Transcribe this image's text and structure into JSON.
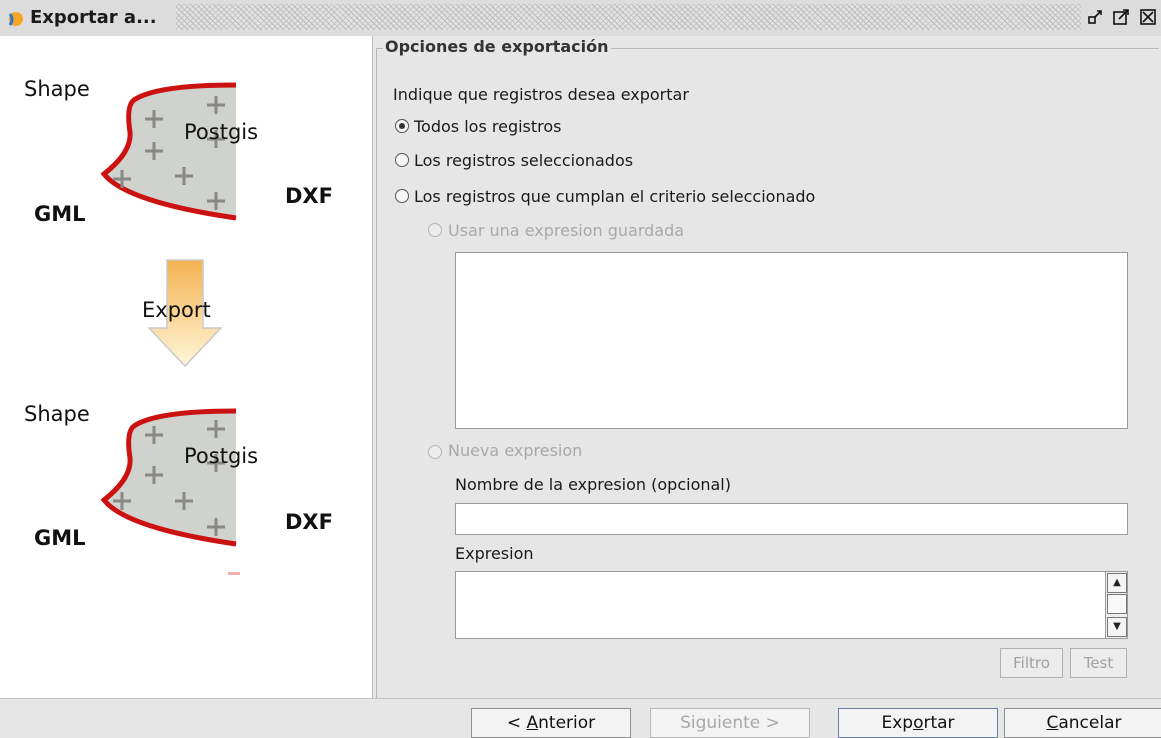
{
  "window": {
    "title": "Exportar a..."
  },
  "illustration": {
    "top": {
      "shape": "Shape",
      "postgis": "Postgis",
      "gml": "GML",
      "dxf": "DXF"
    },
    "arrow_label": "Export",
    "bottom": {
      "shape": "Shape",
      "postgis": "Postgis",
      "gml": "GML",
      "dxf": "DXF"
    }
  },
  "options": {
    "legend": "Opciones de exportación",
    "prompt": "Indique que registros desea exportar",
    "radio_all": "Todos los registros",
    "radio_selected": "Los registros seleccionados",
    "radio_criteria": "Los registros que cumplan el criterio seleccionado",
    "radio_saved": "Usar una expresion guardada",
    "radio_new": "Nueva expresion",
    "name_label": "Nombre de la expresion (opcional)",
    "name_value": "",
    "expr_label": "Expresion",
    "expr_value": "",
    "filter_btn": "Filtro",
    "test_btn": "Test",
    "selected_option": "Todos los registros"
  },
  "nav": {
    "back_mnemonic": "< ",
    "back_underlined": "A",
    "back_rest": "nterior",
    "next": "Siguiente >",
    "export_pre": "Exp",
    "export_underlined": "o",
    "export_rest": "rtar",
    "cancel_underlined": "C",
    "cancel_rest": "ancelar"
  },
  "colors": {
    "curve": "#cc1111",
    "arrow_fill": "#f7c46a",
    "shape_fill": "#d0d2cd"
  }
}
